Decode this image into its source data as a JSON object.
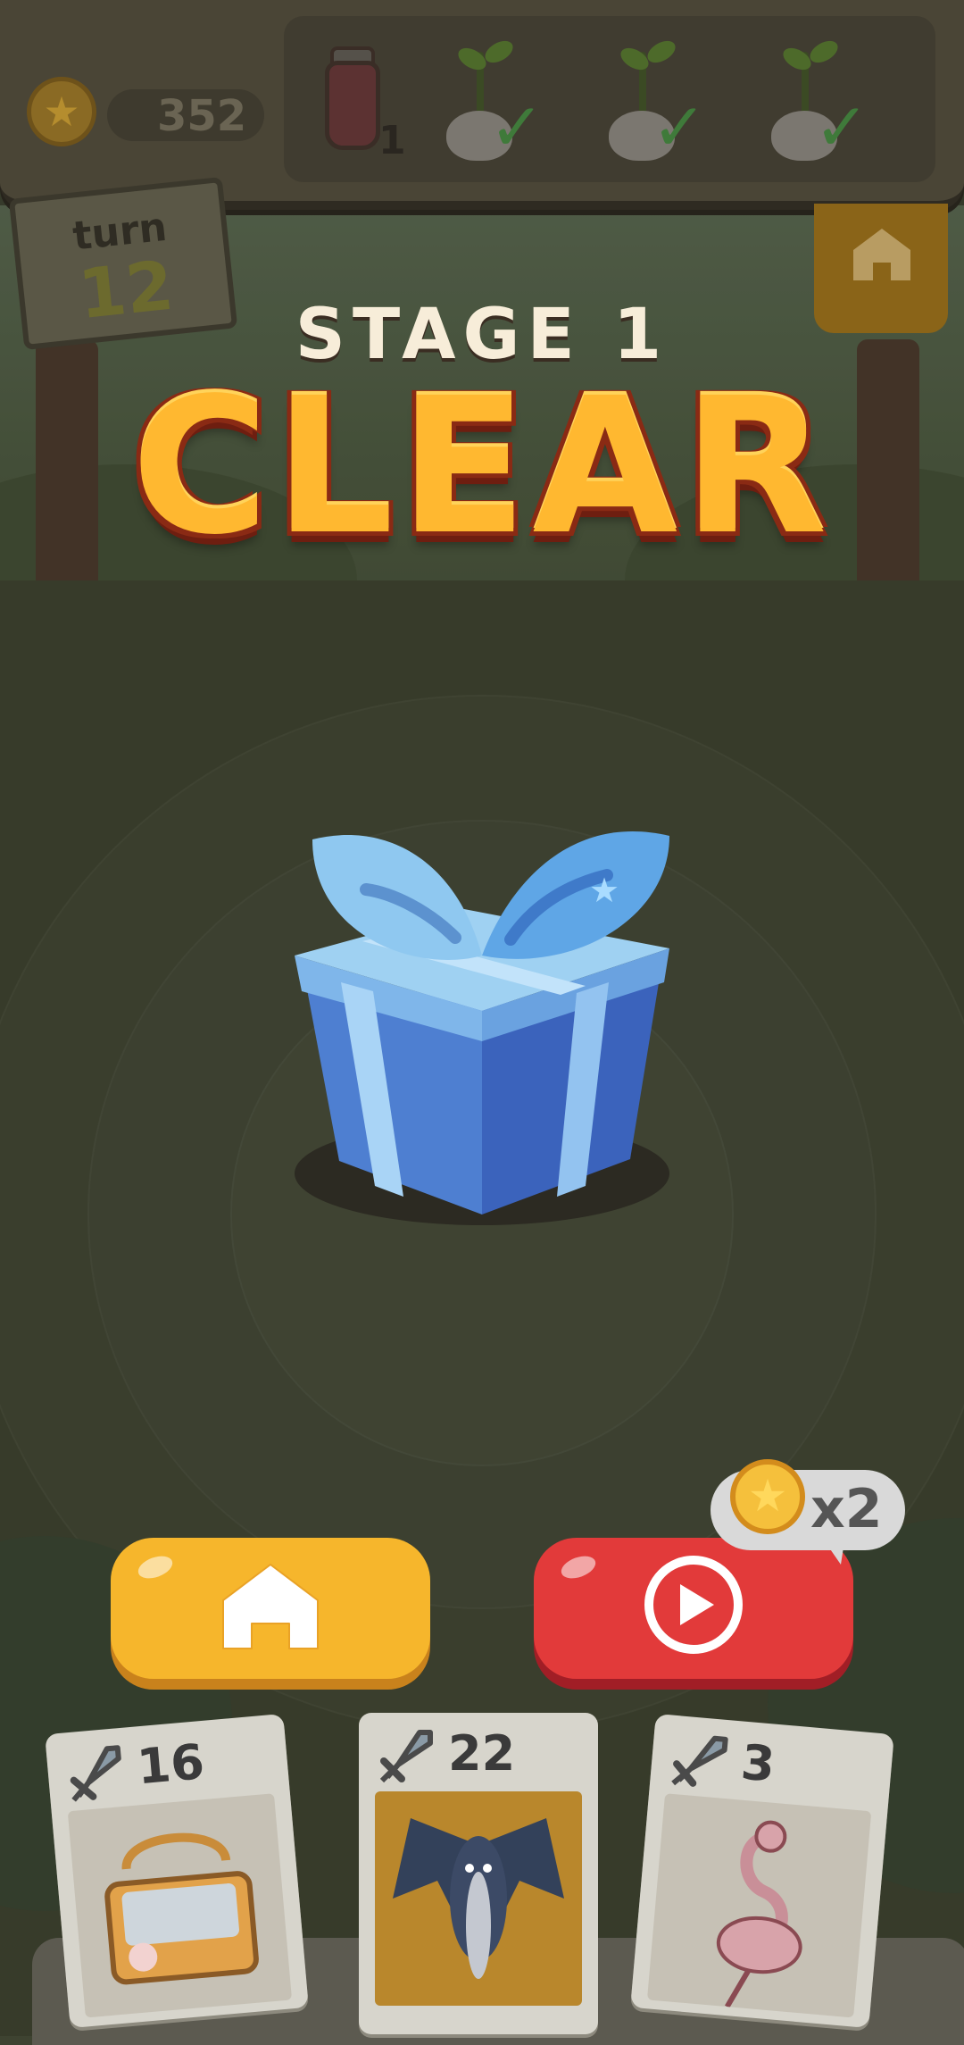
{
  "hud": {
    "coins": "352",
    "items": [
      {
        "name": "jar",
        "qty": "1",
        "icon": "potion-jar-icon"
      },
      {
        "name": "sprout",
        "icon": "sprout-icon",
        "status": "checked"
      },
      {
        "name": "sprout",
        "icon": "sprout-icon",
        "status": "checked"
      },
      {
        "name": "sprout",
        "icon": "sprout-icon",
        "status": "checked"
      }
    ]
  },
  "turn": {
    "label": "turn",
    "value": "12"
  },
  "result": {
    "stage_label": "STAGE 1",
    "status": "CLEAR",
    "reward_icon": "blue-gift-box-icon"
  },
  "buttons": {
    "home_icon": "home-icon",
    "replay_icon": "play-icon",
    "bonus_multiplier": "x2"
  },
  "cards": [
    {
      "attack": "16",
      "icon": "sword-icon",
      "art": "treasure-chest"
    },
    {
      "attack": "22",
      "icon": "sword-icon",
      "art": "bat"
    },
    {
      "attack": "3",
      "icon": "sword-icon",
      "art": "flamingo"
    }
  ],
  "colors": {
    "clear_text": "#ffb830",
    "home_button": "#f6b62c",
    "replay_button": "#e23a3a",
    "gift_blue": "#5a9be0"
  }
}
